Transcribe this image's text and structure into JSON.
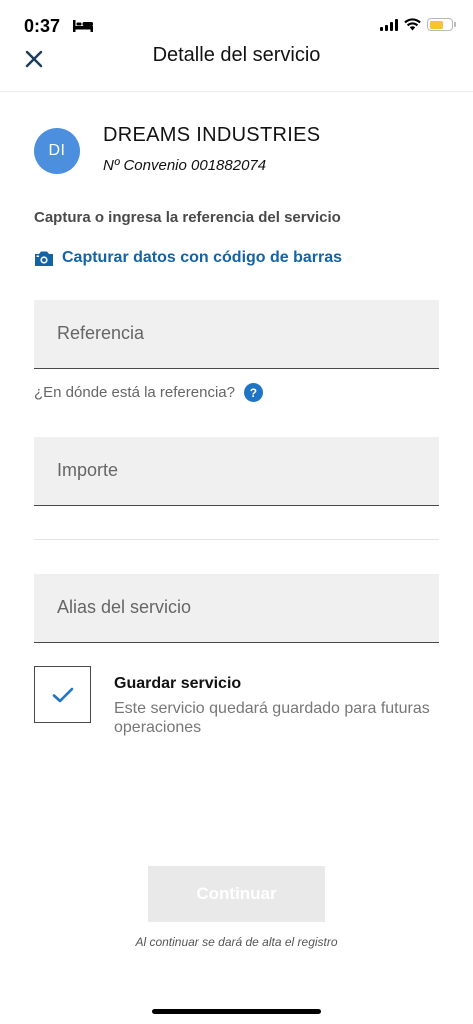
{
  "status_bar": {
    "time": "0:37",
    "battery_level": 0.65,
    "battery_color": "#f6c430"
  },
  "header": {
    "title": "Detalle del servicio",
    "close_icon": "close-icon"
  },
  "company": {
    "initials": "DI",
    "name": "DREAMS INDUSTRIES",
    "convenio": "Nº Convenio 001882074",
    "avatar_color": "#4b8fde"
  },
  "form": {
    "instruction": "Captura o ingresa la referencia del servicio",
    "barcode_link": "Capturar datos con código de barras",
    "barcode_icon": "camera-icon",
    "reference_placeholder": "Referencia",
    "reference_help": "¿En dónde está la referencia?",
    "help_icon_glyph": "?",
    "amount_placeholder": "Importe",
    "alias_placeholder": "Alias del servicio"
  },
  "save_service": {
    "checked": true,
    "title": "Guardar servicio",
    "description": "Este servicio quedará guardado para futuras operaciones"
  },
  "footer": {
    "continue_label": "Continuar",
    "continue_enabled": false,
    "disclaimer": "Al continuar se dará de alta el registro"
  },
  "colors": {
    "link": "#1464a5",
    "accent": "#1f74c4",
    "check": "#1f74c4"
  }
}
